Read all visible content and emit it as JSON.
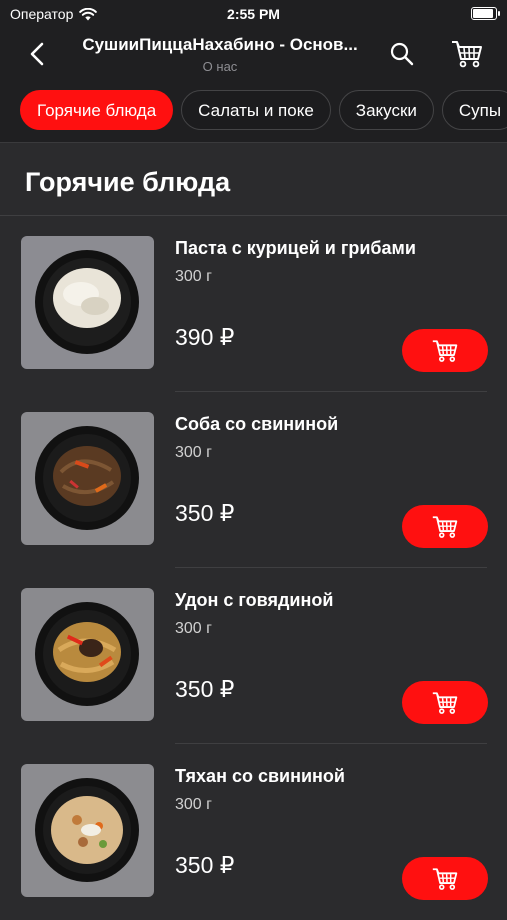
{
  "status_bar": {
    "carrier": "Оператор",
    "time": "2:55 PM"
  },
  "nav": {
    "title": "СушииПиццаНахабино - Основ...",
    "subtitle": "О нас"
  },
  "categories": [
    {
      "label": "Горячие блюда",
      "active": true
    },
    {
      "label": "Салаты и поке",
      "active": false
    },
    {
      "label": "Закуски",
      "active": false
    },
    {
      "label": "Супы",
      "active": false
    }
  ],
  "section": {
    "title": "Горячие блюда"
  },
  "products": [
    {
      "name": "Паста с курицей и грибами",
      "weight": "300 г",
      "price": "390 ₽"
    },
    {
      "name": "Соба со свининой",
      "weight": "300 г",
      "price": "350 ₽"
    },
    {
      "name": "Удон с говядиной",
      "weight": "300 г",
      "price": "350 ₽"
    },
    {
      "name": "Тяхан со свининой",
      "weight": "300 г",
      "price": "350 ₽"
    }
  ],
  "colors": {
    "accent": "#ff1010",
    "background": "#2b2b2d",
    "bar": "#1f1f21"
  },
  "icons": [
    "back-chevron-icon",
    "search-icon",
    "cart-icon",
    "add-to-cart-icon",
    "wifi-icon",
    "battery-icon"
  ]
}
